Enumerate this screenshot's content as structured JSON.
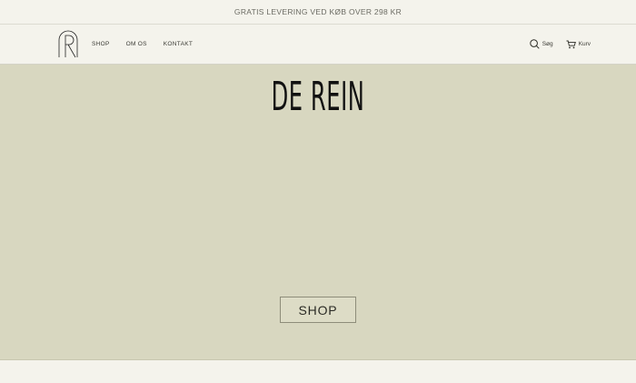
{
  "announcement": {
    "text": "GRATIS LEVERING VED KØB OVER 298 KR"
  },
  "header": {
    "logo_icon": "monogram-R-logo",
    "nav": [
      {
        "label": "SHOP"
      },
      {
        "label": "OM OS"
      },
      {
        "label": "KONTAKT"
      }
    ],
    "search_label": "Søg",
    "cart_label": "Kurv"
  },
  "hero": {
    "title": "DE REIN",
    "button_label": "SHOP",
    "background": "#d8d7c0"
  },
  "colors": {
    "page_bg": "#f4f3ec",
    "text_dark": "#111111",
    "muted": "#6b6b63"
  }
}
